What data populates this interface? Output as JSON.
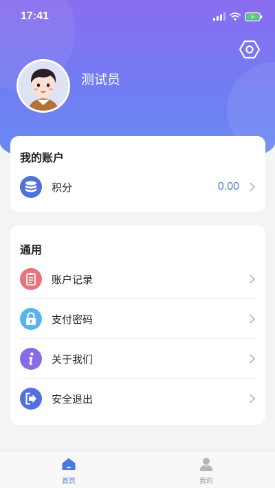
{
  "status_bar": {
    "time": "17:41"
  },
  "profile": {
    "username": "测试员"
  },
  "account_card": {
    "title": "我的账户",
    "points": {
      "label": "积分",
      "value": "0.00"
    }
  },
  "general_card": {
    "title": "通用",
    "items": [
      {
        "label": "账户记录",
        "icon": "clipboard-icon"
      },
      {
        "label": "支付密码",
        "icon": "lock-icon"
      },
      {
        "label": "关于我们",
        "icon": "info-icon"
      },
      {
        "label": "安全退出",
        "icon": "logout-icon"
      }
    ]
  },
  "tabbar": {
    "tabs": [
      {
        "label": "首页",
        "icon": "home-icon",
        "active": true
      },
      {
        "label": "我的",
        "icon": "user-icon",
        "active": false
      }
    ]
  },
  "colors": {
    "accent": "#6a7df2",
    "value_blue": "#4f7ee0",
    "tab_active": "#4a79e0",
    "tab_inactive": "#b5b5b5"
  }
}
